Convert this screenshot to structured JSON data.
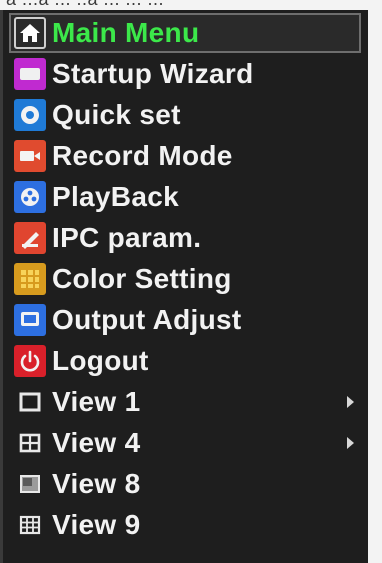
{
  "top_fragment": "a ...a ... ..a ... ... ...",
  "menu": {
    "header": {
      "label": "Main Menu",
      "icon": "home-icon",
      "color": "#3ce84a"
    },
    "items": [
      {
        "label": "Startup Wizard",
        "icon": "wizard-icon",
        "icon_color": "#c02ad0"
      },
      {
        "label": "Quick set",
        "icon": "quick-set-icon",
        "icon_color": "#1f7ad6"
      },
      {
        "label": "Record Mode",
        "icon": "record-icon",
        "icon_color": "#e04b2f"
      },
      {
        "label": "PlayBack",
        "icon": "playback-icon",
        "icon_color": "#2d6fe0"
      },
      {
        "label": "IPC param.",
        "icon": "ipc-icon",
        "icon_color": "#e0452f"
      },
      {
        "label": "Color Setting",
        "icon": "color-grid-icon",
        "icon_color": "#d79b1e"
      },
      {
        "label": "Output Adjust",
        "icon": "monitor-icon",
        "icon_color": "#2d6fe0"
      },
      {
        "label": "Logout",
        "icon": "power-icon",
        "icon_color": "#d9202a"
      },
      {
        "label": "View 1",
        "icon": "view-1-icon",
        "has_submenu": true
      },
      {
        "label": "View 4",
        "icon": "view-4-icon",
        "has_submenu": true
      },
      {
        "label": "View 8",
        "icon": "view-8-icon",
        "has_submenu": false
      },
      {
        "label": "View 9",
        "icon": "view-9-icon",
        "has_submenu": false
      }
    ]
  }
}
